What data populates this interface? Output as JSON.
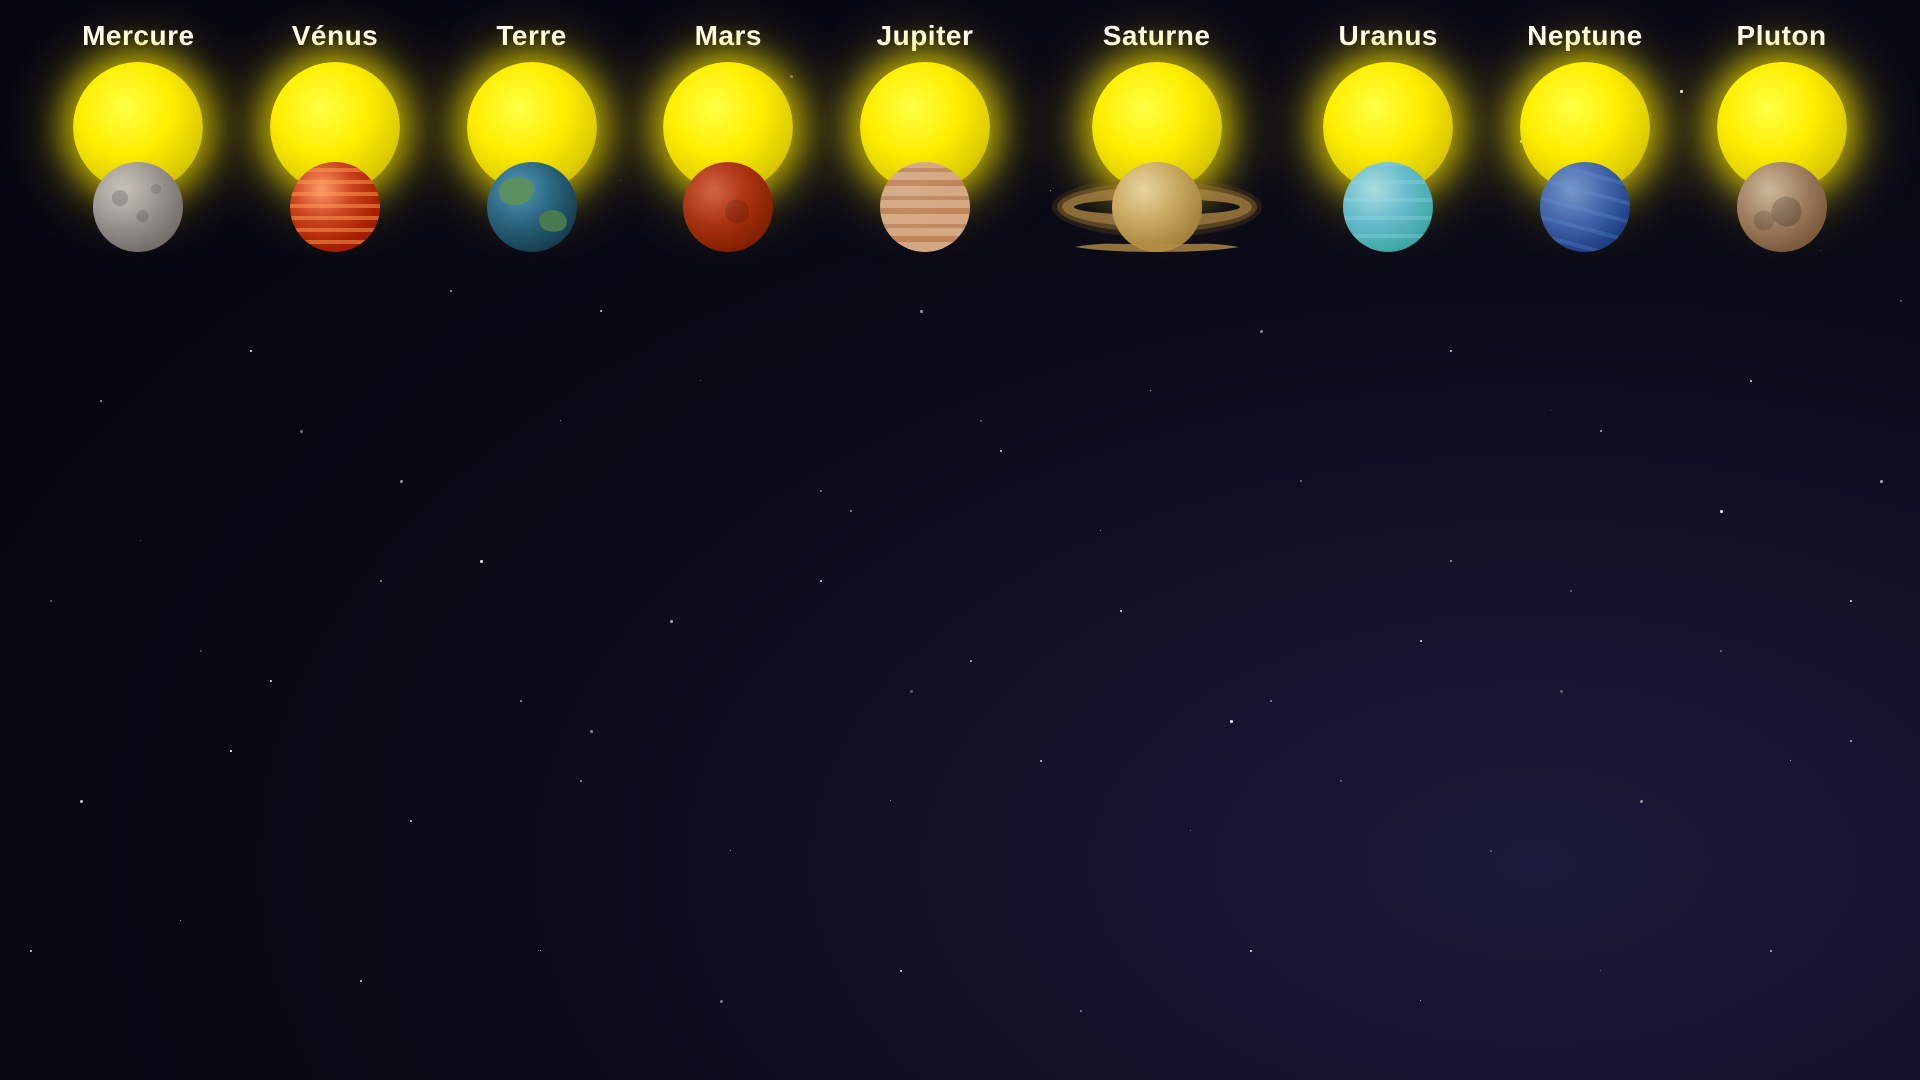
{
  "background": {
    "color": "#0d0d1a"
  },
  "planets": [
    {
      "id": "mercure",
      "label": "Mercure",
      "type": "mercury"
    },
    {
      "id": "venus",
      "label": "Vénus",
      "type": "venus"
    },
    {
      "id": "terre",
      "label": "Terre",
      "type": "earth"
    },
    {
      "id": "mars",
      "label": "Mars",
      "type": "mars"
    },
    {
      "id": "jupiter",
      "label": "Jupiter",
      "type": "jupiter"
    },
    {
      "id": "saturne",
      "label": "Saturne",
      "type": "saturn"
    },
    {
      "id": "uranus",
      "label": "Uranus",
      "type": "uranus"
    },
    {
      "id": "neptune",
      "label": "Neptune",
      "type": "neptune"
    },
    {
      "id": "pluton",
      "label": "Pluton",
      "type": "pluto"
    }
  ]
}
